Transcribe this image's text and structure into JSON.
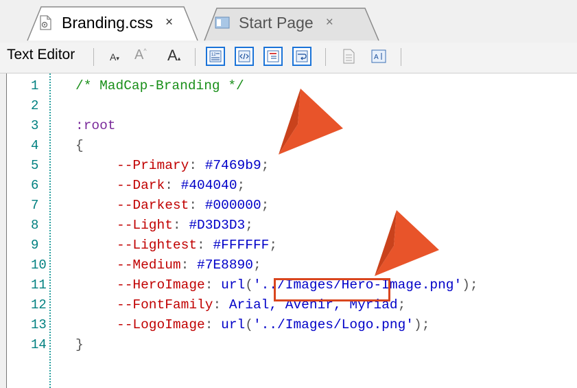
{
  "tabs": [
    {
      "label": "Branding.css",
      "close": "×",
      "icon": "css-file-icon",
      "active": true
    },
    {
      "label": "Start Page",
      "close": "×",
      "icon": "start-page-icon",
      "active": false
    }
  ],
  "toolbar": {
    "label": "Text Editor",
    "font_small": "A",
    "font_large": "A",
    "font_grow": "A",
    "icons": [
      "line-numbers-icon",
      "code-tags-icon",
      "outline-icon",
      "word-wrap-icon",
      "document-icon",
      "text-format-icon"
    ]
  },
  "editor": {
    "line_numbers": [
      "1",
      "2",
      "3",
      "4",
      "5",
      "6",
      "7",
      "8",
      "9",
      "10",
      "11",
      "12",
      "13",
      "14"
    ],
    "code": {
      "l1": "/* MadCap-Branding */",
      "l3": ":root",
      "l4": "{",
      "l5": {
        "prop": "--Primary",
        "val": "#7469b9"
      },
      "l6": {
        "prop": "--Dark",
        "val": "#404040"
      },
      "l7": {
        "prop": "--Darkest",
        "val": "#000000"
      },
      "l8": {
        "prop": "--Light",
        "val": "#D3D3D3"
      },
      "l9": {
        "prop": "--Lightest",
        "val": "#FFFFFF"
      },
      "l10": {
        "prop": "--Medium",
        "val": "#7E8890"
      },
      "l11": {
        "prop": "--HeroImage",
        "fn": "url",
        "str": "'../Images/Hero-Image.png'"
      },
      "l12": {
        "prop": "--FontFamily",
        "val": "Arial, Avenir, Myriad"
      },
      "l13": {
        "prop": "--LogoImage",
        "fn": "url",
        "str": "'../Images/Logo.png'"
      },
      "l14": "}"
    }
  },
  "colors": {
    "accent_arrow": "#e8542a",
    "highlight_box": "#d9461e",
    "toolbar_button_border": "#1a73d8"
  }
}
